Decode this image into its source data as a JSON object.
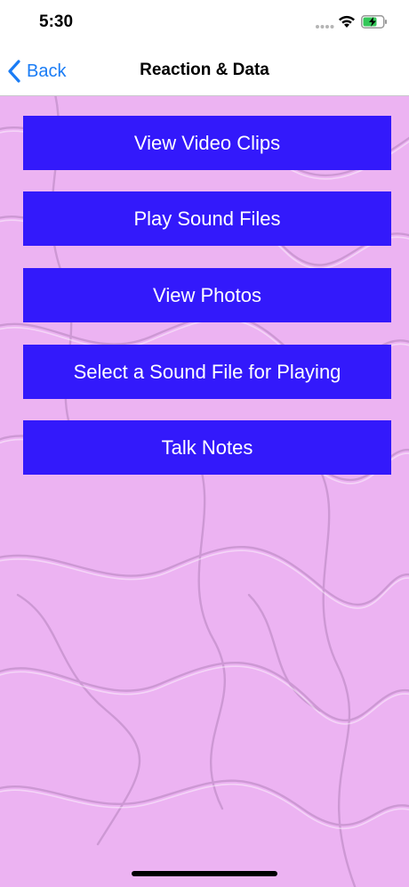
{
  "status_bar": {
    "time": "5:30"
  },
  "nav": {
    "back_label": "Back",
    "title": "Reaction & Data"
  },
  "buttons": [
    {
      "label": "View Video Clips"
    },
    {
      "label": "Play Sound Files"
    },
    {
      "label": "View Photos"
    },
    {
      "label": "Select a Sound File for Playing"
    },
    {
      "label": "Talk Notes"
    }
  ],
  "colors": {
    "accent": "#1a7cf5",
    "button_bg": "#3319fb",
    "background": "#ecb3f2"
  }
}
